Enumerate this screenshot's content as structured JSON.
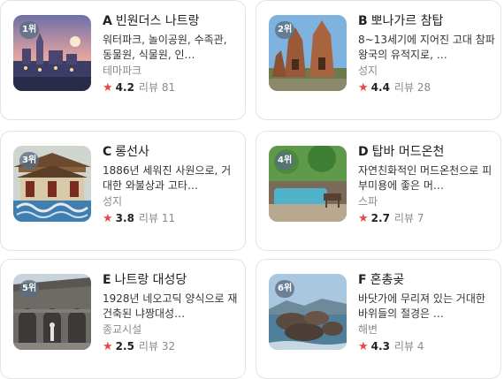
{
  "places": [
    {
      "rank": "1위",
      "letter": "A",
      "name": "빈원더스 나트랑",
      "desc": "워터파크, 놀이공원, 수족관, 동물원, 식물원, 인…",
      "category": "테마파크",
      "rating": "4.2",
      "review_label": "리뷰",
      "review_count": "81",
      "thumb_icon": "theme-park-photo"
    },
    {
      "rank": "2위",
      "letter": "B",
      "name": "뽀나가르 참탑",
      "desc": "8~13세기에 지어진 고대 참파 왕국의 유적지로, …",
      "category": "성지",
      "rating": "4.4",
      "review_label": "리뷰",
      "review_count": "28",
      "thumb_icon": "cham-tower-photo"
    },
    {
      "rank": "3위",
      "letter": "C",
      "name": "롱선사",
      "desc": "1886년 세워진 사원으로, 거대한 와불상과 고타…",
      "category": "성지",
      "rating": "3.8",
      "review_label": "리뷰",
      "review_count": "11",
      "thumb_icon": "temple-photo"
    },
    {
      "rank": "4위",
      "letter": "D",
      "name": "탑바 머드온천",
      "desc": "자연친화적인 머드온천으로 피부미용에 좋은 머…",
      "category": "스파",
      "rating": "2.7",
      "review_label": "리뷰",
      "review_count": "7",
      "thumb_icon": "mud-spa-photo"
    },
    {
      "rank": "5위",
      "letter": "E",
      "name": "나트랑 대성당",
      "desc": "1928년 네오고딕 양식으로 재건축된 냐짱대성…",
      "category": "종교시설",
      "rating": "2.5",
      "review_label": "리뷰",
      "review_count": "32",
      "thumb_icon": "cathedral-photo"
    },
    {
      "rank": "6위",
      "letter": "F",
      "name": "혼총곶",
      "desc": "바닷가에 무리져 있는 거대한 바위들의 절경은 …",
      "category": "해변",
      "rating": "4.3",
      "review_label": "리뷰",
      "review_count": "4",
      "thumb_icon": "rocky-cape-photo"
    }
  ],
  "colors": {
    "star": "#e8464a",
    "rank_badge": "rgba(90,110,130,0.78)",
    "muted": "#8a8a8a"
  }
}
